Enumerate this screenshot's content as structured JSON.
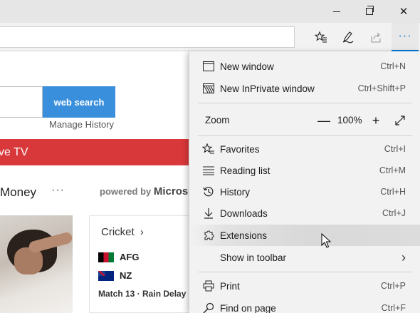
{
  "window": {
    "minimize_icon": "minimize-icon",
    "maximize_icon": "restore-icon",
    "close_glyph": "✕"
  },
  "toolbar": {
    "icons": [
      "favorites-star-icon",
      "pen-icon",
      "share-icon",
      "more-dots-icon"
    ],
    "more_glyph": "···"
  },
  "page": {
    "search_button": "web search",
    "manage_history": "Manage History",
    "banner_text": "ve TV",
    "money_label": "Money",
    "money_dots": "···",
    "powered_by": "powered by",
    "powered_brand": "Microsc",
    "card_title": "Cricket",
    "card_chevron": "›",
    "team1": "AFG",
    "team2": "NZ",
    "match_info": "Match 13 · Rain Delay"
  },
  "menu": {
    "new_window": {
      "label": "New window",
      "shortcut": "Ctrl+N"
    },
    "new_inprivate": {
      "label": "New InPrivate window",
      "shortcut": "Ctrl+Shift+P"
    },
    "zoom": {
      "label": "Zoom",
      "minus": "—",
      "value": "100%",
      "plus": "+"
    },
    "favorites": {
      "label": "Favorites",
      "shortcut": "Ctrl+I"
    },
    "reading_list": {
      "label": "Reading list",
      "shortcut": "Ctrl+M"
    },
    "history": {
      "label": "History",
      "shortcut": "Ctrl+H"
    },
    "downloads": {
      "label": "Downloads",
      "shortcut": "Ctrl+J"
    },
    "extensions": {
      "label": "Extensions"
    },
    "show_in_toolbar": {
      "label": "Show in toolbar",
      "chevron": "›"
    },
    "print": {
      "label": "Print",
      "shortcut": "Ctrl+P"
    },
    "find_on_page": {
      "label": "Find on page",
      "shortcut": "Ctrl+F"
    }
  },
  "colors": {
    "accent": "#0078d7",
    "search_button": "#3a8fdc",
    "banner": "#d9383a",
    "menu_bg": "#f2f2f2",
    "highlight": "#d9d9d9"
  }
}
